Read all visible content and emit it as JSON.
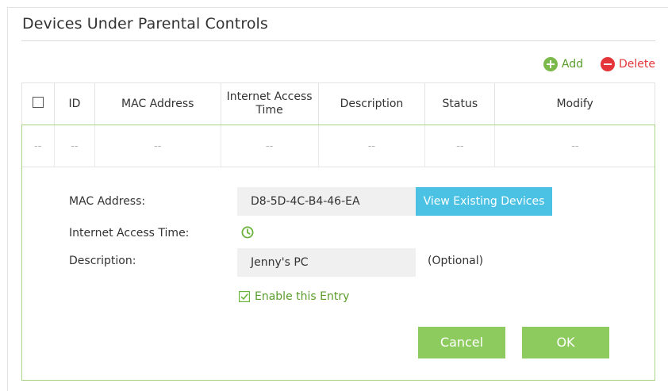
{
  "section": {
    "title": "Devices Under Parental Controls"
  },
  "toolbar": {
    "add_label": "Add",
    "delete_label": "Delete",
    "add_icon": "plus-circle-icon",
    "delete_icon": "minus-circle-icon"
  },
  "table": {
    "columns": [
      "ID",
      "MAC Address",
      "Internet Access\nTime",
      "Description",
      "Status",
      "Modify"
    ],
    "empty_row": [
      "--",
      "--",
      "--",
      "--",
      "--",
      "--",
      "--"
    ]
  },
  "form": {
    "mac_label": "MAC Address:",
    "mac_value": "D8-5D-4C-B4-46-EA",
    "view_devices_label": "View Existing Devices",
    "access_time_label": "Internet Access Time:",
    "access_time_icon": "clock-icon",
    "description_label": "Description:",
    "description_value": "Jenny's PC",
    "optional_hint": "(Optional)",
    "enable_label": "Enable this Entry",
    "enable_checked": true,
    "cancel_label": "Cancel",
    "ok_label": "OK"
  },
  "colors": {
    "accent_green": "#8ecb5e",
    "text_green": "#5a9c2b",
    "delete_red": "#e4363a",
    "info_blue": "#4bc1e4",
    "editor_border": "#a8d483"
  }
}
